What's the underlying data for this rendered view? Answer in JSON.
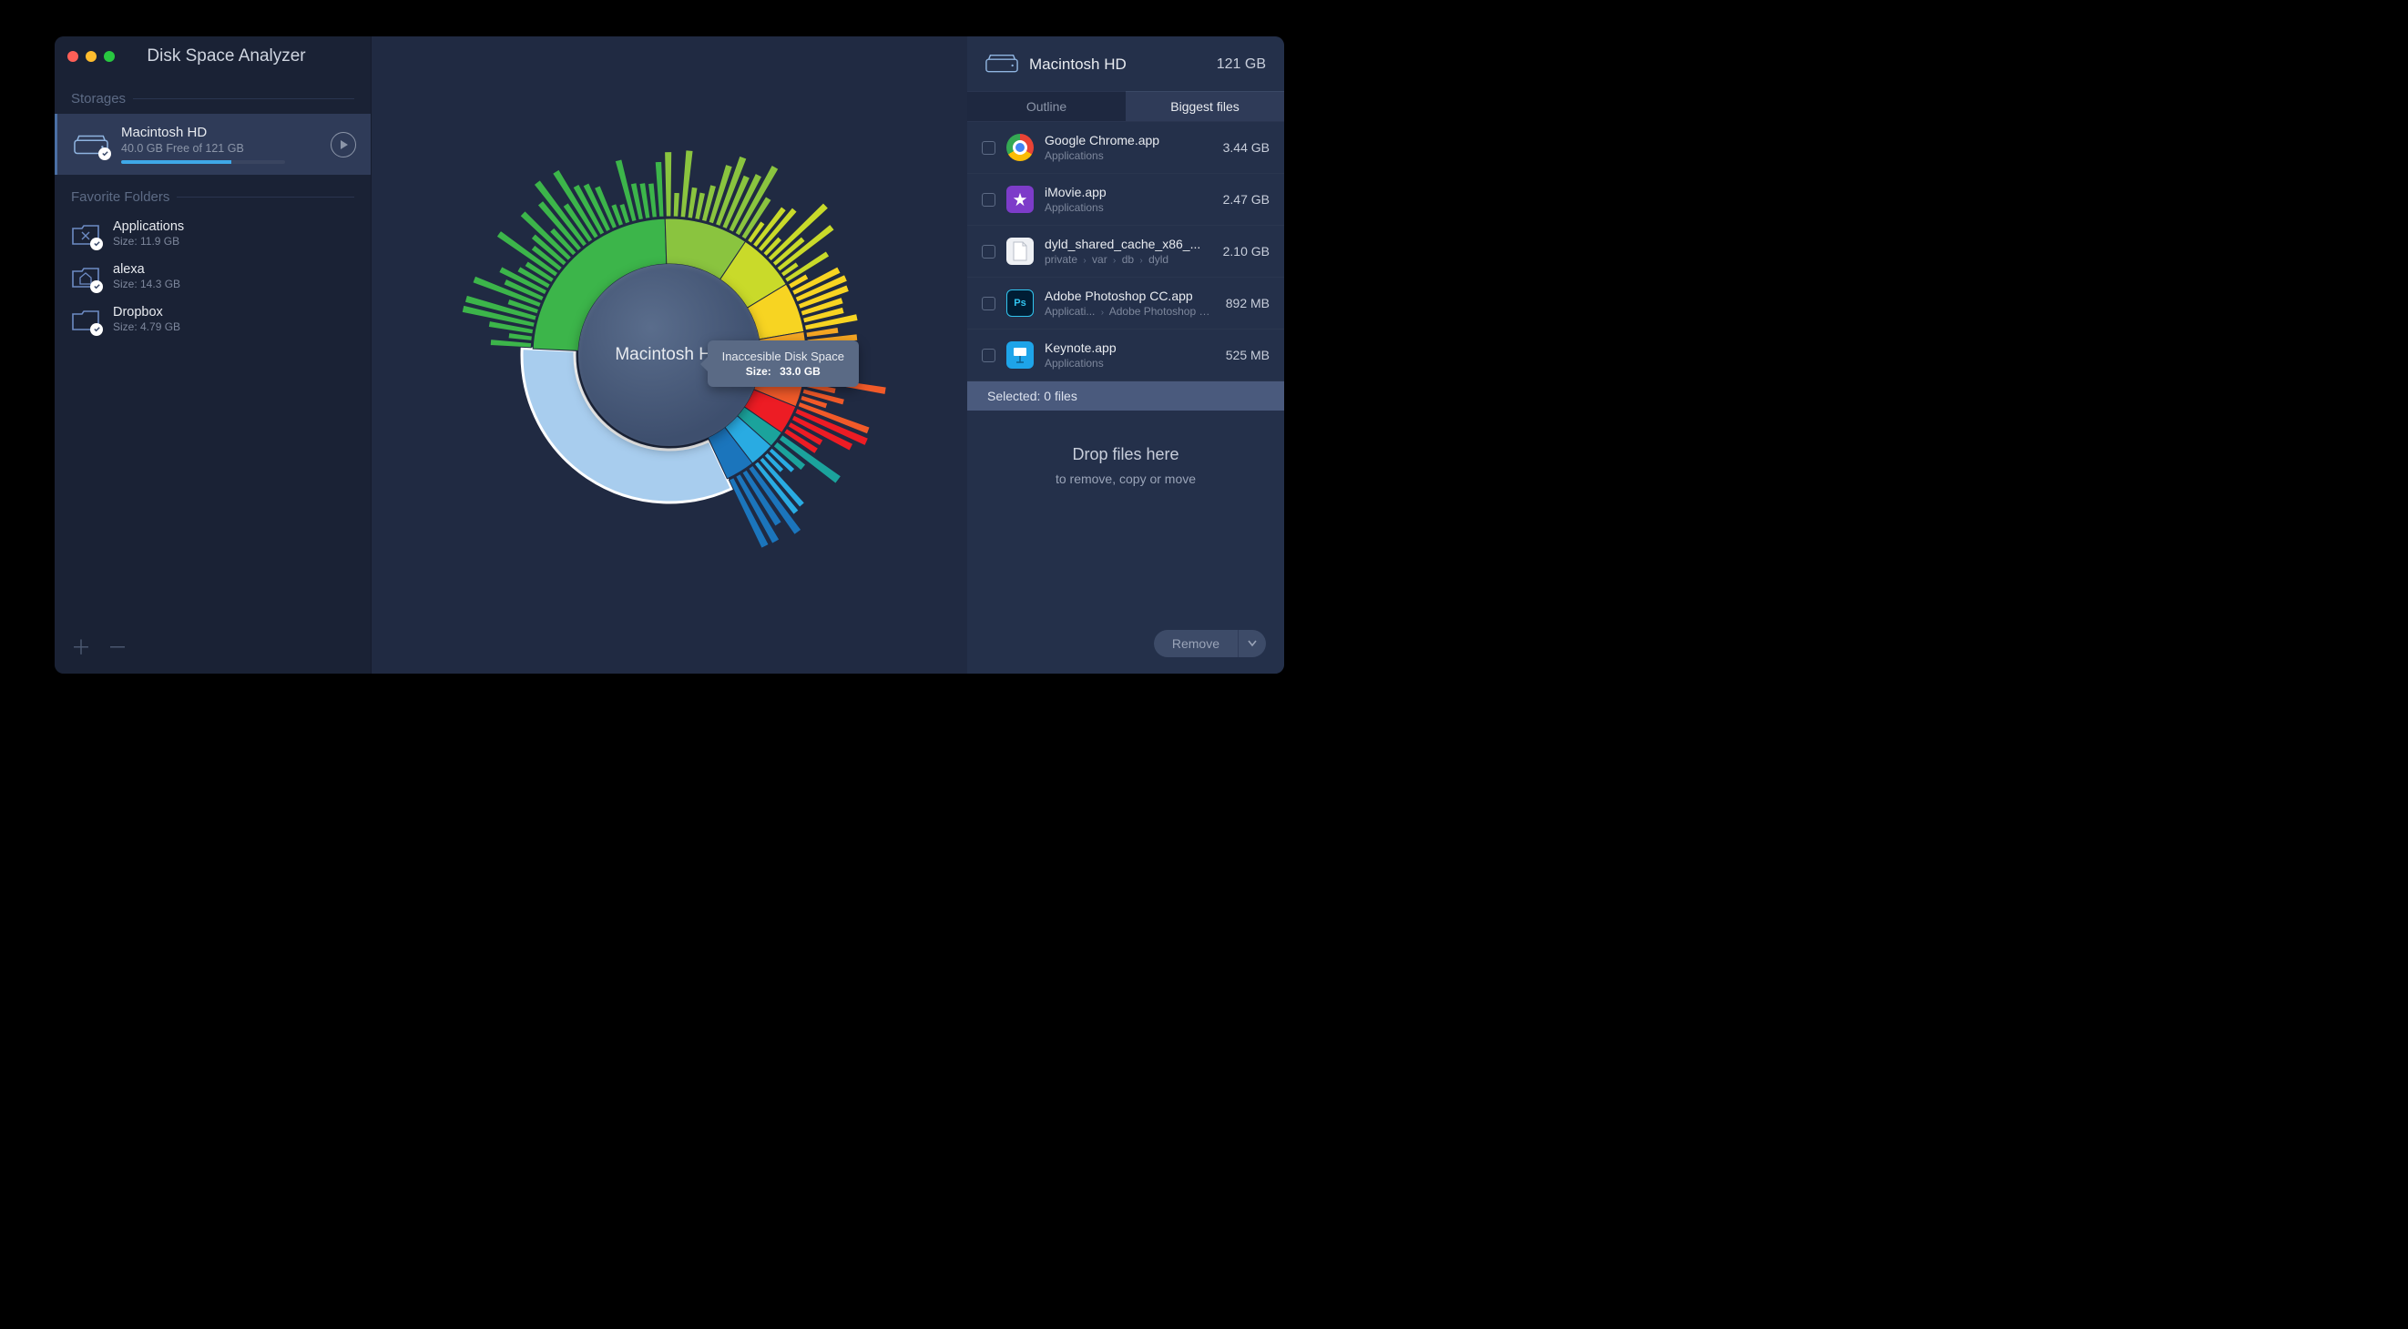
{
  "app_title": "Disk Space Analyzer",
  "sidebar": {
    "storages_label": "Storages",
    "favorites_label": "Favorite Folders",
    "storage": {
      "name": "Macintosh HD",
      "sub": "40.0 GB Free of 121 GB",
      "progress_pct": 67
    },
    "folders": [
      {
        "name": "Applications",
        "size_label": "Size: 11.9 GB",
        "icon": "apps"
      },
      {
        "name": "alexa",
        "size_label": "Size: 14.3 GB",
        "icon": "home"
      },
      {
        "name": "Dropbox",
        "size_label": "Size: 4.79 GB",
        "icon": "folder"
      }
    ]
  },
  "chart_data": {
    "type": "sunburst",
    "title": "Macintosh HD",
    "total_gb": 121,
    "tooltip": {
      "label": "Inaccesible Disk Space",
      "size_label": "Size:",
      "size_value": "33.0 GB"
    },
    "ring1": [
      {
        "name": "Inaccesible Disk Space",
        "value_gb": 33.0,
        "color": "#a8cdee",
        "highlighted": true
      },
      {
        "name": "Green segment",
        "value_gb": 24.0,
        "color": "#3cb54a"
      },
      {
        "name": "Lime segment",
        "value_gb": 10.0,
        "color": "#8ac43f"
      },
      {
        "name": "Yellow-green",
        "value_gb": 7.0,
        "color": "#c9da2a"
      },
      {
        "name": "Yellow",
        "value_gb": 6.0,
        "color": "#f7d422"
      },
      {
        "name": "Orange",
        "value_gb": 5.0,
        "color": "#f5a623"
      },
      {
        "name": "Red-orange",
        "value_gb": 4.0,
        "color": "#f15a29"
      },
      {
        "name": "Red",
        "value_gb": 3.5,
        "color": "#ed1c24"
      },
      {
        "name": "Teal",
        "value_gb": 2.0,
        "color": "#1ba39c"
      },
      {
        "name": "Sky blue",
        "value_gb": 3.0,
        "color": "#29abe2"
      },
      {
        "name": "Blue",
        "value_gb": 3.5,
        "color": "#1b75bc"
      }
    ]
  },
  "right": {
    "disk_name": "Macintosh HD",
    "disk_size": "121 GB",
    "tabs": {
      "outline": "Outline",
      "biggest": "Biggest files",
      "active": "biggest"
    },
    "files": [
      {
        "name": "Google Chrome.app",
        "path": "Applications",
        "size": "3.44 GB",
        "icon": "chrome"
      },
      {
        "name": "iMovie.app",
        "path": "Applications",
        "size": "2.47 GB",
        "icon": "imovie"
      },
      {
        "name": "dyld_shared_cache_x86_...",
        "path": "private › var › db › dyld",
        "size": "2.10 GB",
        "icon": "file"
      },
      {
        "name": "Adobe Photoshop CC.app",
        "path": "Applicati... › Adobe Photoshop CC",
        "size": "892 MB",
        "icon": "ps"
      },
      {
        "name": "Keynote.app",
        "path": "Applications",
        "size": "525 MB",
        "icon": "keynote"
      }
    ],
    "selected_label": "Selected: 0 files",
    "drop_title": "Drop files here",
    "drop_sub": "to remove, copy or move",
    "remove_label": "Remove"
  }
}
